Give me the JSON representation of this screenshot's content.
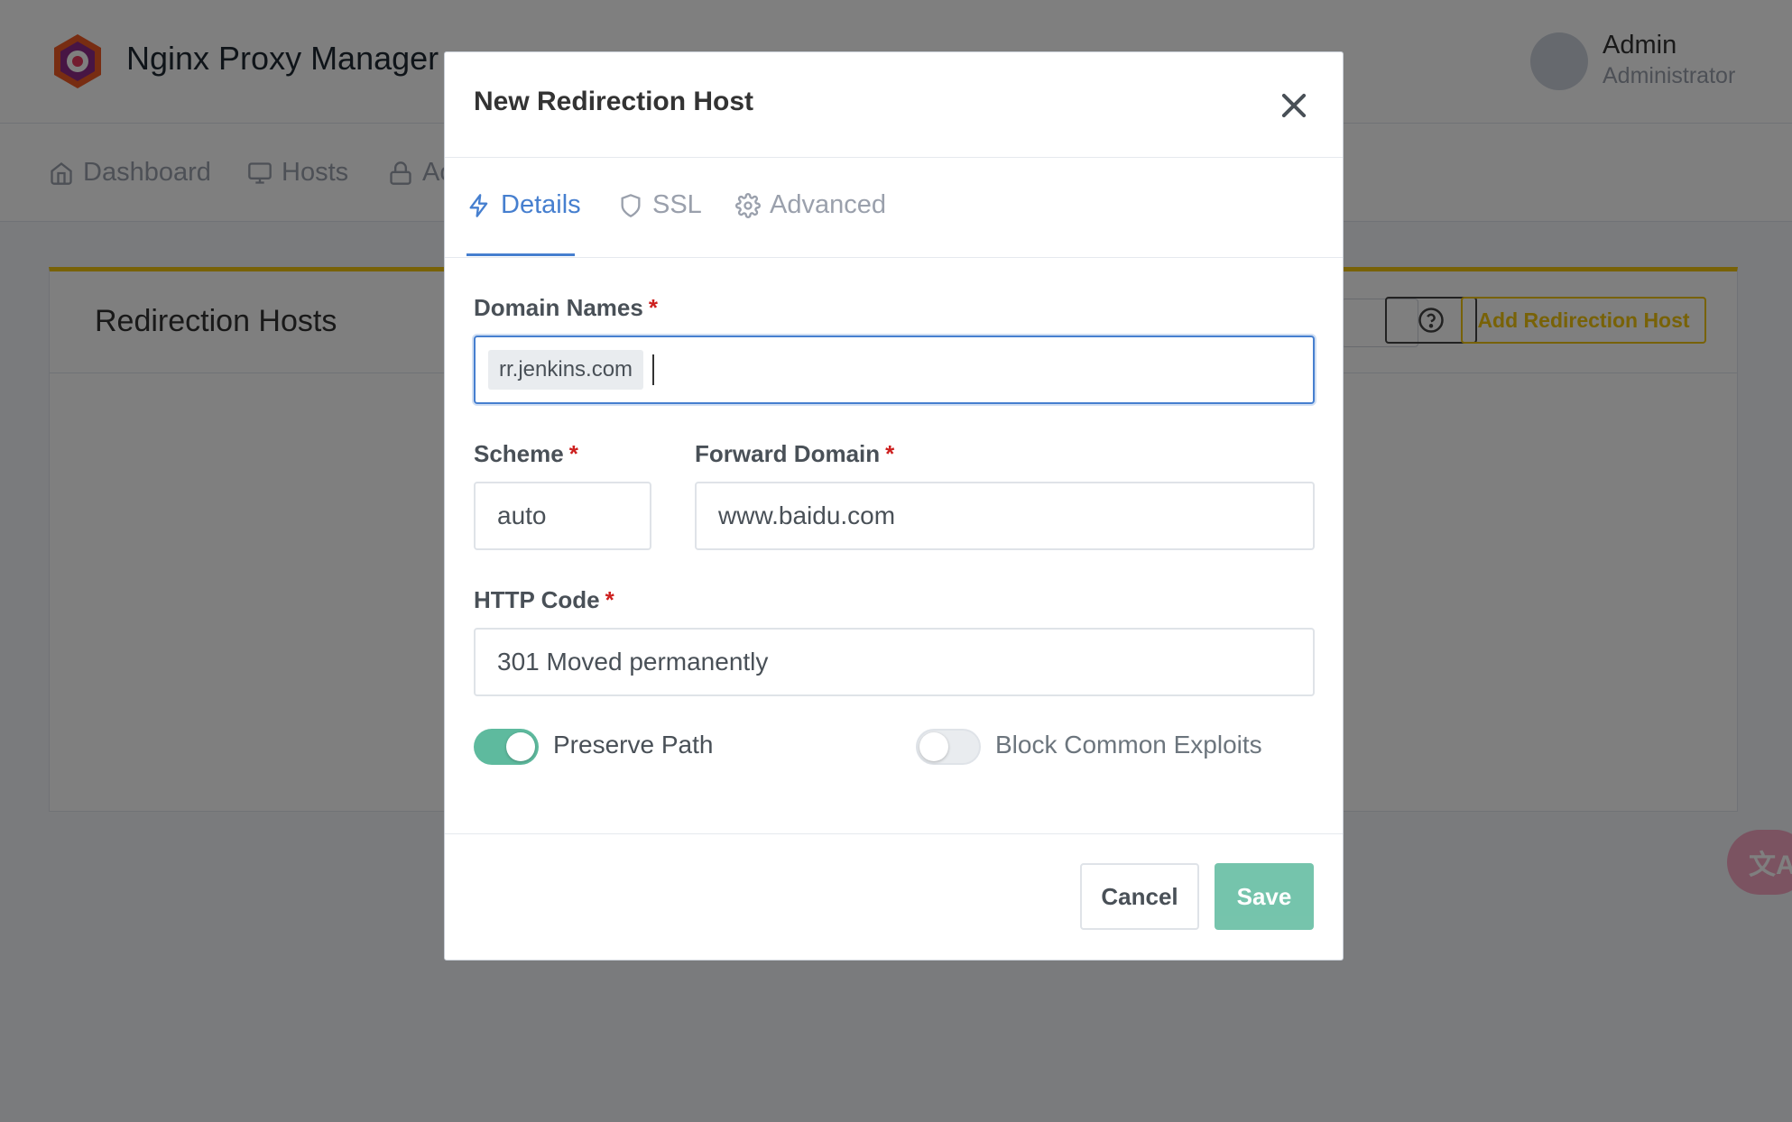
{
  "app": {
    "title": "Nginx Proxy Manager",
    "user_name": "Admin",
    "user_role": "Administrator"
  },
  "nav": {
    "items": [
      {
        "label": "Dashboard",
        "icon": "home-icon"
      },
      {
        "label": "Hosts",
        "icon": "monitor-icon"
      },
      {
        "label": "Ac",
        "icon": "lock-icon"
      }
    ]
  },
  "card": {
    "title": "Redirection Hosts",
    "add_button": "Add Redirection Host"
  },
  "modal": {
    "title": "New Redirection Host",
    "tabs": [
      {
        "label": "Details",
        "icon": "lightning-icon",
        "active": true
      },
      {
        "label": "SSL",
        "icon": "shield-icon",
        "active": false
      },
      {
        "label": "Advanced",
        "icon": "gear-icon",
        "active": false
      }
    ],
    "domain_names": {
      "label": "Domain Names",
      "tags": [
        "rr.jenkins.com"
      ]
    },
    "scheme": {
      "label": "Scheme",
      "value": "auto"
    },
    "forward_domain": {
      "label": "Forward Domain",
      "value": "www.baidu.com"
    },
    "http_code": {
      "label": "HTTP Code",
      "value": "301 Moved permanently"
    },
    "required_mark": "*",
    "preserve_path": {
      "label": "Preserve Path",
      "enabled": true
    },
    "block_exploits": {
      "label": "Block Common Exploits",
      "enabled": false
    },
    "cancel_label": "Cancel",
    "save_label": "Save"
  },
  "colors": {
    "accent": "#467fcf",
    "toggle_on": "#5eba9e",
    "warning": "#f1c40f"
  }
}
